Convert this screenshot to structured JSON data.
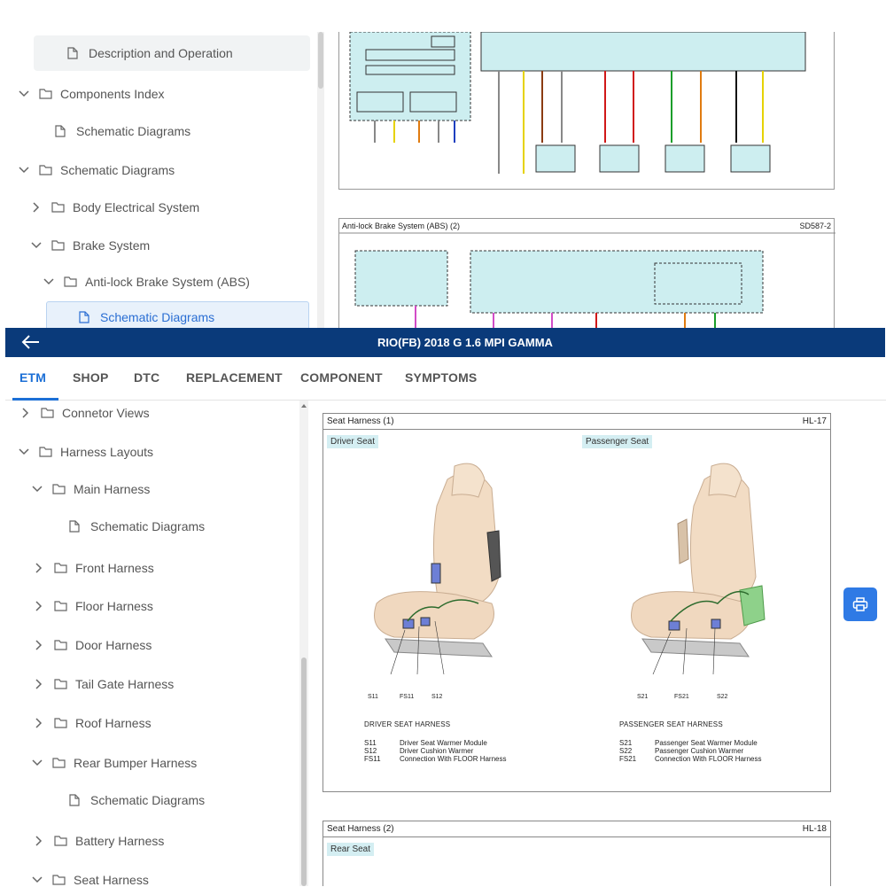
{
  "top_view": {
    "tree": [
      {
        "label": "Description and Operation"
      },
      {
        "label": "Components Index"
      },
      {
        "label": "Schematic Diagrams"
      },
      {
        "label": "Schematic Diagrams"
      },
      {
        "label": "Body Electrical System"
      },
      {
        "label": "Brake System"
      },
      {
        "label": "Anti-lock Brake System (ABS)"
      },
      {
        "label": "Schematic Diagrams"
      }
    ],
    "diagram2": {
      "title": "Anti-lock Brake System (ABS) (2)",
      "code": "SD587-2"
    }
  },
  "header": {
    "title": "RIO(FB) 2018 G 1.6 MPI GAMMA"
  },
  "tabs": [
    {
      "label": "ETM",
      "active": true
    },
    {
      "label": "SHOP"
    },
    {
      "label": "DTC"
    },
    {
      "label": "REPLACEMENT"
    },
    {
      "label": "COMPONENT"
    },
    {
      "label": "SYMPTOMS"
    }
  ],
  "tree": [
    {
      "label": "Connetor Views"
    },
    {
      "label": "Harness Layouts"
    },
    {
      "label": "Main Harness"
    },
    {
      "label": "Schematic Diagrams"
    },
    {
      "label": "Front Harness"
    },
    {
      "label": "Floor Harness"
    },
    {
      "label": "Door Harness"
    },
    {
      "label": "Tail Gate Harness"
    },
    {
      "label": "Roof Harness"
    },
    {
      "label": "Rear Bumper Harness"
    },
    {
      "label": "Schematic Diagrams"
    },
    {
      "label": "Battery Harness"
    },
    {
      "label": "Seat Harness"
    }
  ],
  "content": {
    "box1": {
      "title": "Seat Harness (1)",
      "code": "HL-17",
      "driver": {
        "tag": "Driver Seat",
        "heading": "DRIVER SEAT HARNESS",
        "callouts": [
          "S11",
          "FS11",
          "S12"
        ],
        "legend": [
          {
            "code": "S11",
            "desc": "Driver Seat Warmer Module"
          },
          {
            "code": "S12",
            "desc": "Driver Cushion Warmer"
          },
          {
            "code": "FS11",
            "desc": "Connection With FLOOR Harness"
          }
        ]
      },
      "passenger": {
        "tag": "Passenger Seat",
        "heading": "PASSENGER SEAT HARNESS",
        "callouts": [
          "S21",
          "FS21",
          "S22"
        ],
        "legend": [
          {
            "code": "S21",
            "desc": "Passenger Seat Warmer Module"
          },
          {
            "code": "S22",
            "desc": "Passenger Cushion Warmer"
          },
          {
            "code": "FS21",
            "desc": "Connection With FLOOR Harness"
          }
        ]
      }
    },
    "box2": {
      "title": "Seat Harness (2)",
      "code": "HL-18",
      "tag": "Rear Seat"
    }
  },
  "colors": {
    "header_bg": "#0a3a7a",
    "accent": "#1c6fd6",
    "print_button": "#2f7ae5",
    "diagram_cyan": "#cdeef0"
  }
}
